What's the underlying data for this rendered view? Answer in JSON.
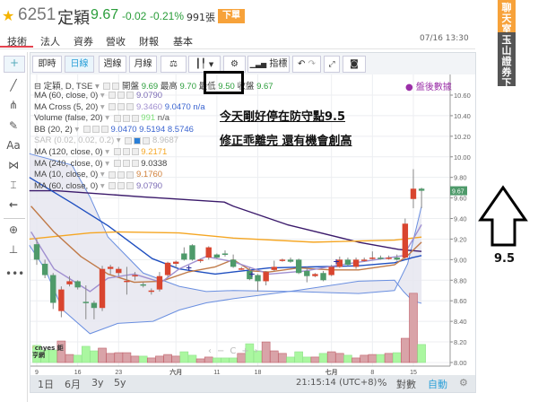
{
  "header": {
    "code": "6251",
    "name": "定穎",
    "price": "9.67",
    "change": "-0.02",
    "change_pct": "-0.21%",
    "volume": "991張",
    "order_button": "下單",
    "time": "07/16 13:30"
  },
  "tabs": [
    {
      "label": "技術",
      "active": true
    },
    {
      "label": "法人"
    },
    {
      "label": "資券"
    },
    {
      "label": "營收"
    },
    {
      "label": "財報"
    },
    {
      "label": "基本"
    }
  ],
  "side_tabs": [
    {
      "label": "聊天室",
      "color": "#f7a23a"
    },
    {
      "label": "玉山證券下單",
      "color": "#555555"
    }
  ],
  "left_tools": [
    "crosshair-icon",
    "line-icon",
    "pitchfork-icon",
    "brush-icon",
    "text-icon",
    "pattern-icon",
    "measure-icon",
    "back-arrow-icon",
    "zoom-icon",
    "ruler-icon",
    "more-icon"
  ],
  "left_tool_text": {
    "text": "Aa",
    "more": "•••"
  },
  "toolbar": {
    "realtime": "即時",
    "daily": "日線",
    "weekly": "週線",
    "monthly": "月線",
    "compare": "⚖",
    "indicators": "指標"
  },
  "legend": {
    "main": {
      "label": "定穎, D, TSE",
      "open_label": "開盤",
      "open": "9.69",
      "high_label": "最高",
      "high": "9.70",
      "low_label": "最低",
      "low": "9.50",
      "close_label": "收盤",
      "close": "9.67"
    },
    "rows": [
      {
        "label": "MA (60, close, 0)",
        "values": [
          "9.0790"
        ],
        "colors": [
          "#7b6bb5"
        ]
      },
      {
        "label": "MA Cross (5, 20)",
        "values": [
          "9.3460",
          "9.0470",
          "n/a"
        ],
        "colors": [
          "#a08fd0",
          "#3a64d0",
          "#3a64d0"
        ]
      },
      {
        "label": "Volume (false, 20)",
        "values": [
          "991",
          "n/a"
        ],
        "colors": [
          "#7fe07a",
          "#555"
        ]
      },
      {
        "label": "BB (20, 2)",
        "values": [
          "9.0470 9.5194 8.5746"
        ],
        "colors": [
          "#3a64d0"
        ]
      },
      {
        "label": "SAR (0.02, 0.02, 0.2)",
        "values": [
          "8.9687"
        ],
        "colors": [
          "#bbb"
        ],
        "faded": true
      },
      {
        "label": "MA (120, close, 0)",
        "values": [
          "9.2171"
        ],
        "colors": [
          "#f5a623"
        ]
      },
      {
        "label": "MA (240, close, 0)",
        "values": [
          "9.0338"
        ],
        "colors": [
          "#444"
        ]
      },
      {
        "label": "MA (10, close, 0)",
        "values": [
          "9.1760"
        ],
        "colors": [
          "#d0803a"
        ]
      },
      {
        "label": "MA (60, close, 0)",
        "values": [
          "9.0790"
        ],
        "colors": [
          "#7b6bb5"
        ]
      }
    ]
  },
  "after_hours": "盤後數據",
  "annotation": {
    "line1": "今天剛好停在防守點9.5",
    "line2": "修正乖離完 還有機會創高"
  },
  "side_annotation": {
    "label": "9.5"
  },
  "bottom": {
    "ranges": [
      "1日",
      "6月",
      "3y",
      "5y"
    ],
    "clock": "21:15:14 (UTC+8)",
    "percent": "%",
    "log": "對數",
    "auto": "自動"
  },
  "logo_text": "cnyes 鉅亨網",
  "chart_data": {
    "type": "candlestick",
    "ylim": [
      8.0,
      10.6
    ],
    "yticks": [
      "10.60",
      "10.40",
      "10.20",
      "10.00",
      "9.80",
      "9.60",
      "9.40",
      "9.20",
      "9.00",
      "8.80",
      "8.60",
      "8.40",
      "8.20",
      "8.00"
    ],
    "xticks": [
      {
        "i": 0,
        "label": "9"
      },
      {
        "i": 5,
        "label": "16"
      },
      {
        "i": 10,
        "label": "23"
      },
      {
        "i": 17,
        "label": "六月"
      },
      {
        "i": 22,
        "label": "11"
      },
      {
        "i": 27,
        "label": "18"
      },
      {
        "i": 36,
        "label": "七月"
      },
      {
        "i": 41,
        "label": "8"
      },
      {
        "i": 46,
        "label": "15"
      }
    ],
    "last_price": "9.67",
    "up_color": "#d9452f",
    "down_color": "#4e9a6a",
    "ohlc": [
      [
        9.15,
        9.2,
        8.95,
        9.0
      ],
      [
        8.96,
        9.0,
        8.82,
        8.85
      ],
      [
        8.85,
        8.87,
        8.52,
        8.58
      ],
      [
        8.5,
        8.74,
        8.44,
        8.71
      ],
      [
        8.76,
        8.84,
        8.74,
        8.79
      ],
      [
        8.79,
        8.8,
        8.71,
        8.73
      ],
      [
        8.59,
        8.75,
        8.42,
        8.58
      ],
      [
        8.58,
        8.6,
        8.42,
        8.53
      ],
      [
        8.53,
        8.94,
        8.5,
        8.91
      ],
      [
        8.91,
        8.95,
        8.86,
        8.93
      ],
      [
        8.87,
        8.93,
        8.84,
        8.91
      ],
      [
        8.79,
        8.93,
        8.66,
        8.795
      ],
      [
        8.84,
        8.88,
        8.8,
        8.85
      ],
      [
        8.76,
        8.78,
        8.73,
        8.75
      ],
      [
        8.69,
        8.72,
        8.66,
        8.7
      ],
      [
        8.71,
        8.88,
        8.69,
        8.84
      ],
      [
        8.85,
        8.98,
        8.83,
        8.97
      ],
      [
        8.96,
        8.99,
        8.92,
        8.98
      ],
      [
        9.06,
        9.12,
        8.99,
        9.0
      ],
      [
        9.14,
        9.15,
        8.99,
        9.0
      ],
      [
        8.99,
        9.01,
        8.97,
        9.0
      ],
      [
        9.02,
        9.13,
        9.0,
        9.12
      ],
      [
        9.05,
        9.06,
        9.01,
        9.02
      ],
      [
        9.06,
        9.09,
        9.03,
        9.05
      ],
      [
        9.0,
        9.05,
        8.92,
        8.93
      ],
      [
        8.91,
        8.93,
        8.9,
        8.915
      ],
      [
        8.89,
        8.92,
        8.8,
        8.81
      ],
      [
        8.85,
        8.86,
        8.69,
        8.79
      ],
      [
        8.79,
        8.89,
        8.75,
        8.88
      ],
      [
        8.9,
        8.99,
        8.89,
        8.93
      ],
      [
        8.99,
        9.01,
        8.98,
        9.0
      ],
      [
        9.0,
        9.02,
        8.97,
        8.98
      ],
      [
        9.0,
        9.01,
        8.86,
        8.87
      ],
      [
        8.89,
        8.93,
        8.78,
        8.84
      ],
      [
        8.84,
        8.87,
        8.83,
        8.86
      ],
      [
        8.87,
        8.89,
        8.79,
        8.8
      ],
      [
        8.85,
        8.95,
        8.84,
        8.93
      ],
      [
        8.93,
        9.03,
        8.92,
        9.0
      ],
      [
        9.0,
        9.02,
        8.94,
        8.95
      ],
      [
        8.93,
        9.02,
        8.91,
        9.0
      ],
      [
        8.99,
        9.02,
        8.98,
        9.0
      ],
      [
        9.01,
        9.08,
        9.0,
        9.02
      ],
      [
        9.02,
        9.04,
        9.0,
        9.01
      ],
      [
        9.01,
        9.04,
        9.0,
        9.02
      ],
      [
        9.02,
        9.05,
        8.99,
        9.0
      ],
      [
        9.02,
        9.4,
        9.0,
        9.35
      ],
      [
        9.59,
        9.88,
        9.5,
        9.69
      ],
      [
        9.69,
        9.7,
        9.5,
        9.67
      ]
    ],
    "volume": [
      940,
      690,
      690,
      1180,
      440,
      400,
      890,
      640,
      790,
      500,
      540,
      540,
      350,
      350,
      250,
      350,
      440,
      350,
      590,
      400,
      200,
      300,
      250,
      250,
      250,
      500,
      1030,
      640,
      1130,
      640,
      500,
      300,
      590,
      300,
      300,
      500,
      590,
      500,
      400,
      250,
      400,
      440,
      440,
      500,
      540,
      1330,
      3800,
      991
    ],
    "lines": [
      {
        "name": "MA (60, close, 0)",
        "color": "#3b1a6b",
        "points": [
          [
            -0.9,
            9.67
          ],
          [
            2.4,
            9.67
          ],
          [
            13,
            9.61
          ],
          [
            22.9,
            9.56
          ],
          [
            24,
            9.52
          ],
          [
            30.6,
            9.34
          ],
          [
            39.3,
            9.17
          ],
          [
            44.2,
            9.1
          ],
          [
            47,
            9.08
          ]
        ]
      },
      {
        "name": "BB (20, 2)",
        "color": "#1f4fc0",
        "points": [
          [
            -0.9,
            9.8
          ],
          [
            4.3,
            9.55
          ],
          [
            8.7,
            9.33
          ],
          [
            14.1,
            9.01
          ],
          [
            17.4,
            8.91
          ],
          [
            21.8,
            8.86
          ],
          [
            24,
            8.88
          ],
          [
            28.4,
            8.92
          ],
          [
            33.8,
            8.93
          ],
          [
            39.3,
            8.94
          ],
          [
            43.7,
            8.97
          ],
          [
            45.9,
            9.02
          ],
          [
            47,
            9.04
          ]
        ]
      },
      {
        "name": "MA (120, close, 0)",
        "color": "#f5a623",
        "points": [
          [
            -0.9,
            9.2
          ],
          [
            6.5,
            9.26
          ],
          [
            9.9,
            9.27
          ],
          [
            17.4,
            9.26
          ],
          [
            24,
            9.21
          ],
          [
            33.8,
            9.17
          ],
          [
            43.7,
            9.19
          ],
          [
            47,
            9.22
          ]
        ]
      },
      {
        "name": "MA (10, close, 0)",
        "color": "#c07a48",
        "points": [
          [
            -0.7,
            9.52
          ],
          [
            2.1,
            9.27
          ],
          [
            5.4,
            9.03
          ],
          [
            8.7,
            8.86
          ],
          [
            11.9,
            8.78
          ],
          [
            15.2,
            8.79
          ],
          [
            18.5,
            8.88
          ],
          [
            21.8,
            8.93
          ],
          [
            24,
            9.0
          ],
          [
            26.2,
            8.89
          ],
          [
            28.4,
            8.88
          ],
          [
            32,
            8.92
          ],
          [
            36.0,
            8.9
          ],
          [
            39.3,
            8.9
          ],
          [
            43.7,
            8.95
          ],
          [
            45.3,
            9.04
          ],
          [
            47,
            9.17
          ]
        ]
      },
      {
        "name": "MA Cross (5, 20)",
        "color": "#a08fd0",
        "points": [
          [
            -0.7,
            9.27
          ],
          [
            2.1,
            8.91
          ],
          [
            4.3,
            8.8
          ],
          [
            6.5,
            8.69
          ],
          [
            8.7,
            8.82
          ],
          [
            11.9,
            8.86
          ],
          [
            15.2,
            8.78
          ],
          [
            17.4,
            8.91
          ],
          [
            20.7,
            9.03
          ],
          [
            24,
            8.98
          ],
          [
            28.4,
            8.86
          ],
          [
            32.8,
            8.89
          ],
          [
            37.1,
            8.95
          ],
          [
            41.5,
            9.0
          ],
          [
            44.8,
            9.04
          ],
          [
            47,
            9.34
          ]
        ]
      }
    ],
    "bollinger": {
      "upper": [
        [
          -0.9,
          10.03
        ],
        [
          4.3,
          9.92
        ],
        [
          6.5,
          9.61
        ],
        [
          8.7,
          9.22
        ],
        [
          13,
          8.87
        ],
        [
          17.4,
          8.74
        ],
        [
          20.7,
          8.69
        ],
        [
          24,
          8.7
        ],
        [
          31.7,
          8.69
        ],
        [
          39.3,
          8.67
        ],
        [
          43.7,
          8.7
        ],
        [
          45.3,
          8.96
        ],
        [
          47,
          9.52
        ]
      ],
      "lower": [
        [
          -0.9,
          9.14
        ],
        [
          1,
          8.91
        ],
        [
          3.2,
          8.51
        ],
        [
          6.5,
          8.28
        ],
        [
          9.9,
          8.38
        ],
        [
          14.2,
          8.4
        ],
        [
          17.4,
          8.51
        ],
        [
          20.7,
          8.58
        ],
        [
          24,
          8.62
        ],
        [
          31.7,
          8.7
        ],
        [
          39.3,
          8.79
        ],
        [
          43.7,
          8.8
        ],
        [
          44.8,
          8.69
        ],
        [
          45.9,
          8.6
        ],
        [
          47,
          8.575
        ]
      ],
      "fill": "#e6e6f0"
    },
    "sar": [
      [
        18.5,
        8.92
      ],
      [
        26.2,
        8.86
      ],
      [
        36.5,
        8.98
      ]
    ]
  }
}
